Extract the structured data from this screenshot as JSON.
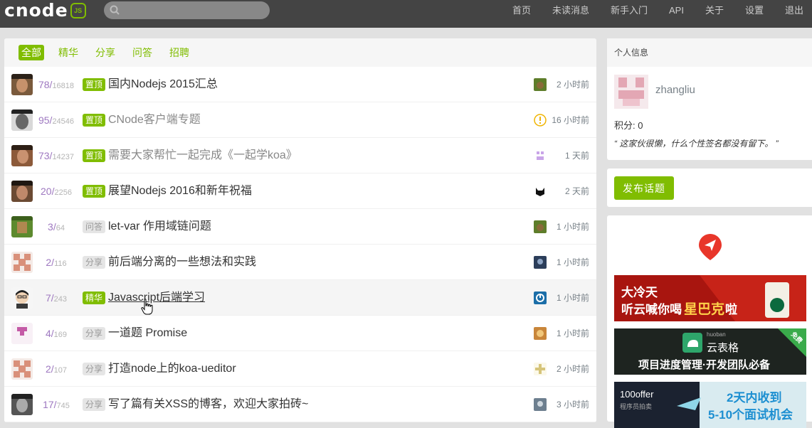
{
  "navbar": {
    "logo_text": "cnode",
    "logo_badge": "JS",
    "search_placeholder": "",
    "links": [
      "首页",
      "未读消息",
      "新手入门",
      "API",
      "关于",
      "设置",
      "退出"
    ]
  },
  "tabs": [
    "全部",
    "精华",
    "分享",
    "问答",
    "招聘"
  ],
  "active_tab": "全部",
  "topics": [
    {
      "replies": "78",
      "visits": "16818",
      "tag": "置顶",
      "tag_style": "green",
      "title": "国内Nodejs 2015汇总",
      "time": "2 小时前",
      "visited": false
    },
    {
      "replies": "95",
      "visits": "24546",
      "tag": "置顶",
      "tag_style": "green",
      "title": "CNode客户端专题",
      "time": "16 小时前",
      "visited": true
    },
    {
      "replies": "73",
      "visits": "14237",
      "tag": "置顶",
      "tag_style": "green",
      "title": "需要大家帮忙一起完成《一起学koa》",
      "time": "1 天前",
      "visited": true
    },
    {
      "replies": "20",
      "visits": "2256",
      "tag": "置顶",
      "tag_style": "green",
      "title": "展望Nodejs 2016和新年祝福",
      "time": "2 天前",
      "visited": false
    },
    {
      "replies": "3",
      "visits": "64",
      "tag": "问答",
      "tag_style": "grey",
      "title": "let-var 作用域链问题",
      "time": "1 小时前",
      "visited": false
    },
    {
      "replies": "2",
      "visits": "116",
      "tag": "分享",
      "tag_style": "grey",
      "title": "前后端分离的一些想法和实践",
      "time": "1 小时前",
      "visited": false
    },
    {
      "replies": "7",
      "visits": "243",
      "tag": "精华",
      "tag_style": "green",
      "title": "Javascript后端学习",
      "time": "1 小时前",
      "visited": false
    },
    {
      "replies": "4",
      "visits": "169",
      "tag": "分享",
      "tag_style": "grey",
      "title": "一道题 Promise",
      "time": "1 小时前",
      "visited": false
    },
    {
      "replies": "2",
      "visits": "107",
      "tag": "分享",
      "tag_style": "grey",
      "title": "打造node上的koa-ueditor",
      "time": "2 小时前",
      "visited": false
    },
    {
      "replies": "17",
      "visits": "745",
      "tag": "分享",
      "tag_style": "grey",
      "title": "写了篇有关XSS的博客，欢迎大家拍砖~",
      "time": "3 小时前",
      "visited": false
    }
  ],
  "sidebar": {
    "profile_heading": "个人信息",
    "username": "zhangliu",
    "score": "积分: 0",
    "signature": "“ 这家伙很懒，什么个性签名都没有留下。 ”",
    "publish_button": "发布话题",
    "ads": [
      {
        "line1": "大冷天",
        "line2": "听云喊你喝",
        "line3": "星巴克",
        "line4": "啦"
      },
      {
        "brand_small": "huoban",
        "brand": "云表格",
        "tagline": "项目进度管理·开发团队必备",
        "corner": "免费"
      },
      {
        "brand": "100offer",
        "brand_sub": "程序员拍卖",
        "line1": "2天内收到",
        "line2": "5-10个面试机会"
      }
    ]
  },
  "colors": {
    "accent": "#80bd01",
    "navbar": "#444444",
    "reply_count": "#9e78c0",
    "background": "#e1e1e1"
  }
}
